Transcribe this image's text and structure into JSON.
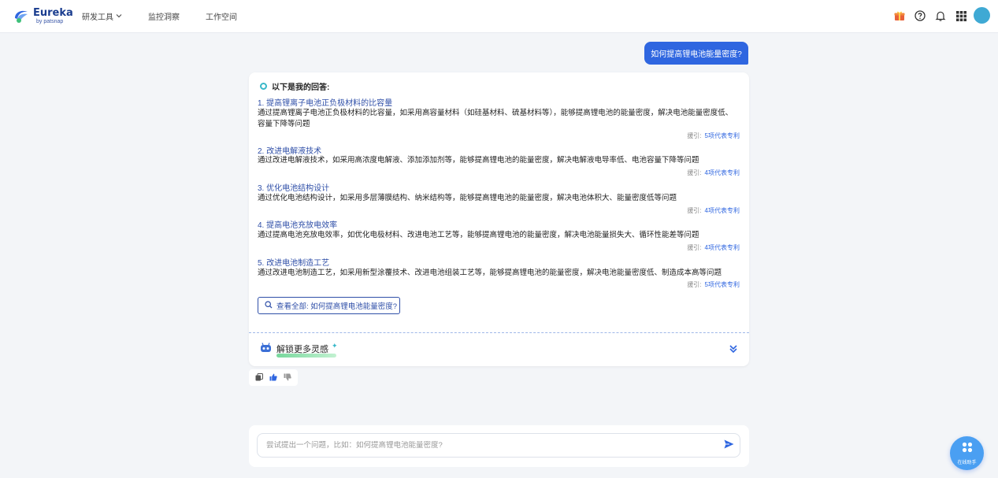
{
  "header": {
    "logo_title": "Eureka",
    "logo_sub": "by patsnap",
    "nav": [
      {
        "label": "研发工具",
        "has_dropdown": true
      },
      {
        "label": "监控洞察",
        "has_dropdown": false
      },
      {
        "label": "工作空间",
        "has_dropdown": false
      }
    ],
    "icons": [
      "gift-icon",
      "help-icon",
      "bell-icon",
      "apps-grid-icon",
      "avatar"
    ]
  },
  "question": "如何提高锂电池能量密度?",
  "answer": {
    "heading": "以下是我的回答:",
    "ref_label": "援引:",
    "items": [
      {
        "title": "1. 提高锂离子电池正负极材料的比容量",
        "desc": "通过提高锂离子电池正负极材料的比容量，如采用高容量材料（如硅基材料、硫基材料等），能够提高锂电池的能量密度，解决电池能量密度低、容量下降等问题",
        "ref": "5项代表专利"
      },
      {
        "title": "2. 改进电解液技术",
        "desc": "通过改进电解液技术，如采用高浓度电解液、添加添加剂等，能够提高锂电池的能量密度，解决电解液电导率低、电池容量下降等问题",
        "ref": "4项代表专利"
      },
      {
        "title": "3. 优化电池结构设计",
        "desc": "通过优化电池结构设计，如采用多层薄膜结构、纳米结构等，能够提高锂电池的能量密度，解决电池体积大、能量密度低等问题",
        "ref": "4项代表专利"
      },
      {
        "title": "4. 提高电池充放电效率",
        "desc": "通过提高电池充放电效率，如优化电极材料、改进电池工艺等，能够提高锂电池的能量密度，解决电池能量损失大、循环性能差等问题",
        "ref": "4项代表专利"
      },
      {
        "title": "5. 改进电池制造工艺",
        "desc": "通过改进电池制造工艺，如采用新型涂覆技术、改进电池组装工艺等，能够提高锂电池的能量密度，解决电池能量密度低、制造成本高等问题",
        "ref": "5项代表专利"
      }
    ],
    "view_all": "查看全部: 如何提高锂电池能量密度?",
    "unlock": "解锁更多灵感"
  },
  "input": {
    "placeholder": "尝试提出一个问题，比如：如何提高锂电池能量密度?",
    "value": ""
  },
  "helper_label": "在线助手",
  "colors": {
    "primary": "#2f66e0",
    "link": "#2f4fa8",
    "avatar": "#3fa9d4",
    "background": "#f3f5f8"
  }
}
